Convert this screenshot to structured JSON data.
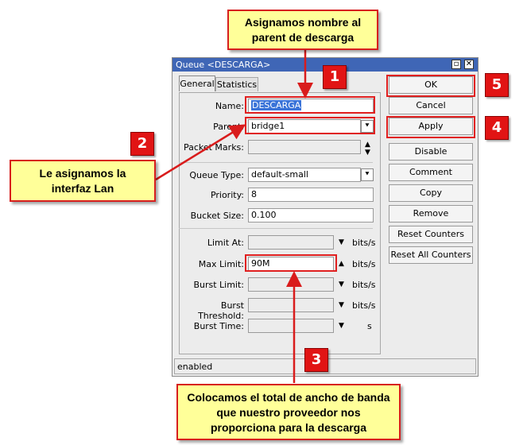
{
  "window": {
    "title": "Queue <DESCARGA>",
    "tabs": [
      "General",
      "Statistics"
    ]
  },
  "fields": {
    "name": {
      "label": "Name:",
      "value": "DESCARGA"
    },
    "parent": {
      "label": "Parent:",
      "value": "bridge1"
    },
    "packet_marks": {
      "label": "Packet Marks:",
      "value": ""
    },
    "queue_type": {
      "label": "Queue Type:",
      "value": "default-small"
    },
    "priority": {
      "label": "Priority:",
      "value": "8"
    },
    "bucket_size": {
      "label": "Bucket Size:",
      "value": "0.100"
    },
    "limit_at": {
      "label": "Limit At:",
      "value": "",
      "unit": "bits/s"
    },
    "max_limit": {
      "label": "Max Limit:",
      "value": "90M",
      "unit": "bits/s"
    },
    "burst_limit": {
      "label": "Burst Limit:",
      "value": "",
      "unit": "bits/s"
    },
    "burst_threshold": {
      "label": "Burst Threshold:",
      "value": "",
      "unit": "bits/s"
    },
    "burst_time": {
      "label": "Burst Time:",
      "value": "",
      "unit": "s"
    }
  },
  "buttons": [
    "OK",
    "Cancel",
    "Apply",
    "Disable",
    "Comment",
    "Copy",
    "Remove",
    "Reset Counters",
    "Reset All Counters"
  ],
  "status": "enabled",
  "annotations": {
    "badges": [
      "1",
      "2",
      "3",
      "4",
      "5"
    ],
    "note_parent": "Asignamos nombre al parent de descarga",
    "note_lan": "Le asignamos la interfaz Lan",
    "note_total": "Colocamos el total de ancho de banda que nuestro proveedor nos proporciona para la descarga"
  },
  "colors": {
    "titlebar": "#3f66b6",
    "annotation_red": "#e02020",
    "note_bg": "#ffff99"
  },
  "icons": [
    "minimize-icon",
    "close-icon",
    "dropdown-arrow-icon",
    "spinner-icon"
  ]
}
